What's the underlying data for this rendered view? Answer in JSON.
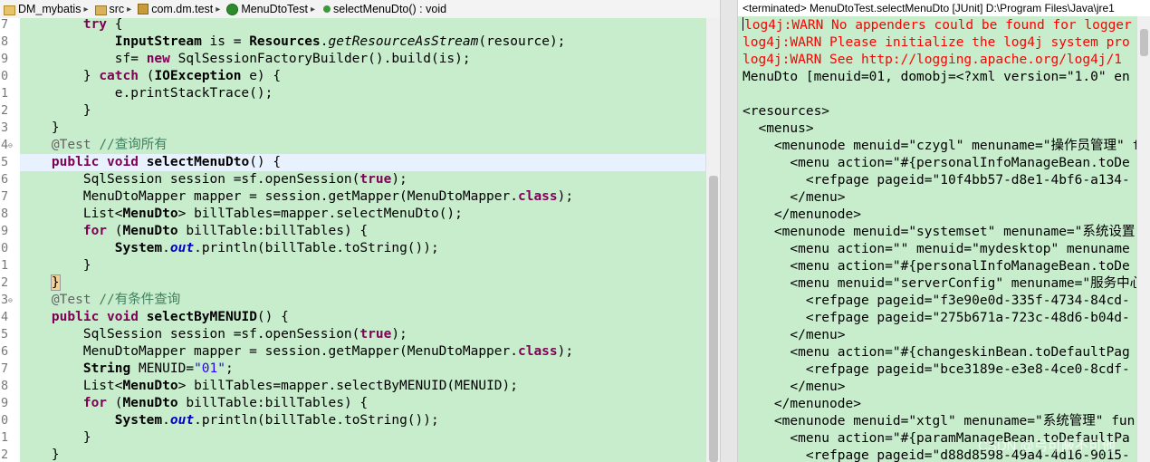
{
  "breadcrumb": {
    "project": "DM_mybatis",
    "src": "src",
    "package": "com.dm.test",
    "class": "MenuDtoTest",
    "method": "selectMenuDto() : void"
  },
  "editor": {
    "line_numbers": [
      "7",
      "8",
      "9",
      "0",
      "1",
      "2",
      "3",
      "4",
      "5",
      "6",
      "7",
      "8",
      "9",
      "0",
      "1",
      "2",
      "3",
      "4",
      "5",
      "6",
      "7",
      "8",
      "9",
      "0",
      "1",
      "2"
    ],
    "comment_query_all": "//查询所有",
    "comment_query_cond": "//有条件查询",
    "str_01": "\"01\""
  },
  "console": {
    "title": "<terminated> MenuDtoTest.selectMenuDto [JUnit] D:\\Program Files\\Java\\jre1",
    "lines": [
      "log4j:WARN No appenders could be found for logger",
      "log4j:WARN Please initialize the log4j system pro",
      "log4j:WARN See http://logging.apache.org/log4j/1",
      "MenuDto [menuid=01, domobj=<?xml version=\"1.0\" en",
      "",
      "<resources>",
      "  <menus>",
      "    <menunode menuid=\"czygl\" menuname=\"操作员管理\" f",
      "      <menu action=\"#{personalInfoManageBean.toDe",
      "        <refpage pageid=\"10f4bb57-d8e1-4bf6-a134-",
      "      </menu>",
      "    </menunode>",
      "    <menunode menuid=\"systemset\" menuname=\"系统设置",
      "      <menu action=\"\" menuid=\"mydesktop\" menuname",
      "      <menu action=\"#{personalInfoManageBean.toDe",
      "      <menu menuid=\"serverConfig\" menuname=\"服务中心",
      "        <refpage pageid=\"f3e90e0d-335f-4734-84cd-",
      "        <refpage pageid=\"275b671a-723c-48d6-b04d-",
      "      </menu>",
      "      <menu action=\"#{changeskinBean.toDefaultPag",
      "        <refpage pageid=\"bce3189e-e3e8-4ce0-8cdf-",
      "      </menu>",
      "    </menunode>",
      "    <menunode menuid=\"xtgl\" menuname=\"系统管理\" fun",
      "      <menu action=\"#{paramManageBean.toDefaultPa",
      "        <refpage pageid=\"d88d8598-49a4-4d16-9015-"
    ]
  },
  "watermark": "CSDN @弓可蔽不可他"
}
